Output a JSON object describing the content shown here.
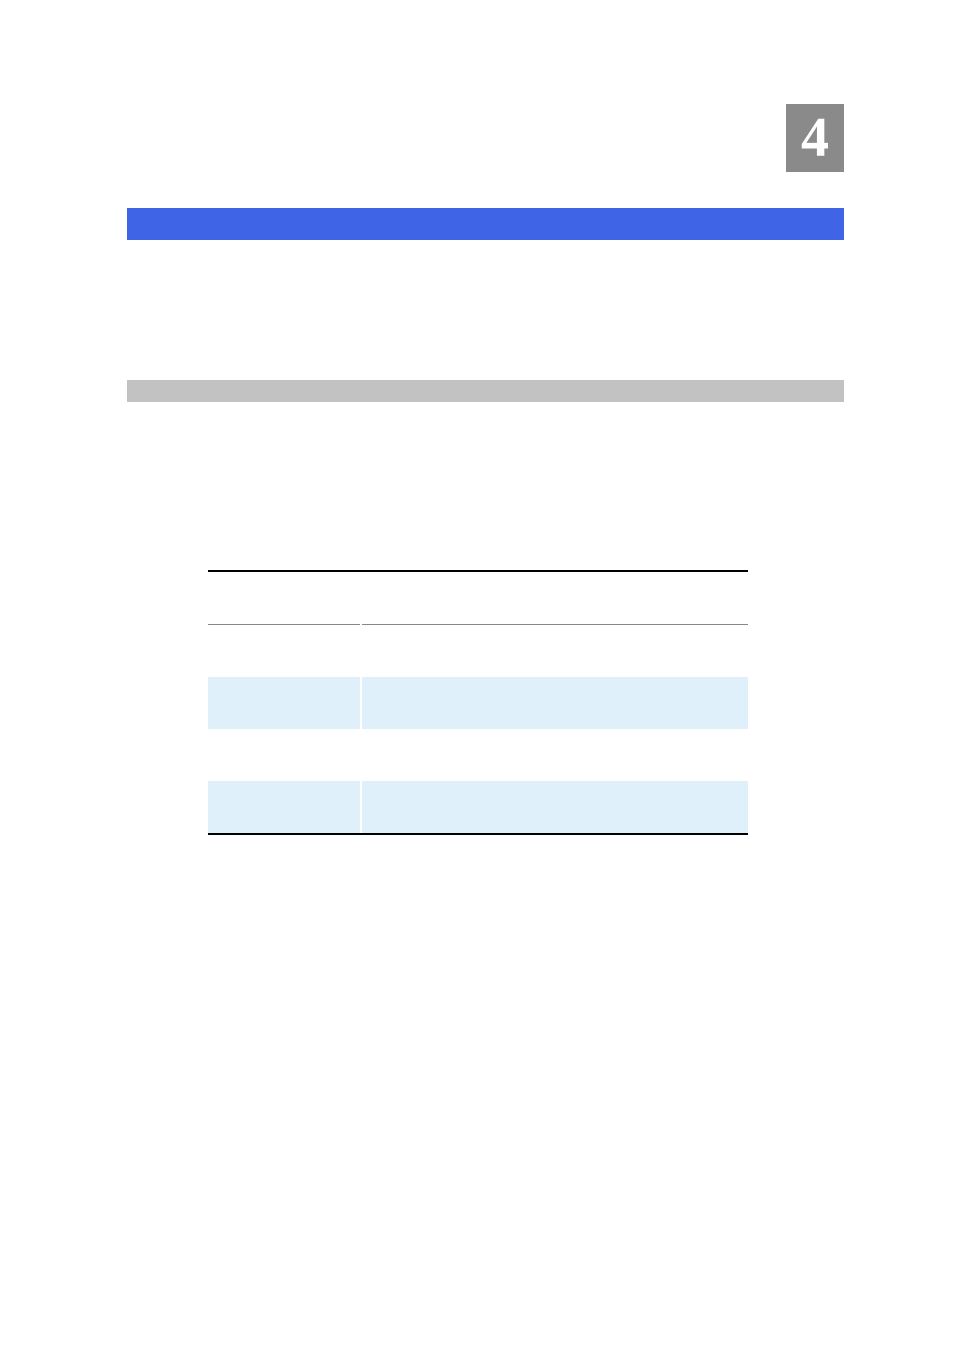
{
  "chapter": {
    "number": "4"
  },
  "table": {
    "headers": [
      "",
      ""
    ],
    "rows": [
      {
        "col1": "",
        "col2": "",
        "highlighted": false
      },
      {
        "col1": "",
        "col2": "",
        "highlighted": true
      },
      {
        "col1": "",
        "col2": "",
        "highlighted": false
      },
      {
        "col1": "",
        "col2": "",
        "highlighted": true
      }
    ]
  }
}
